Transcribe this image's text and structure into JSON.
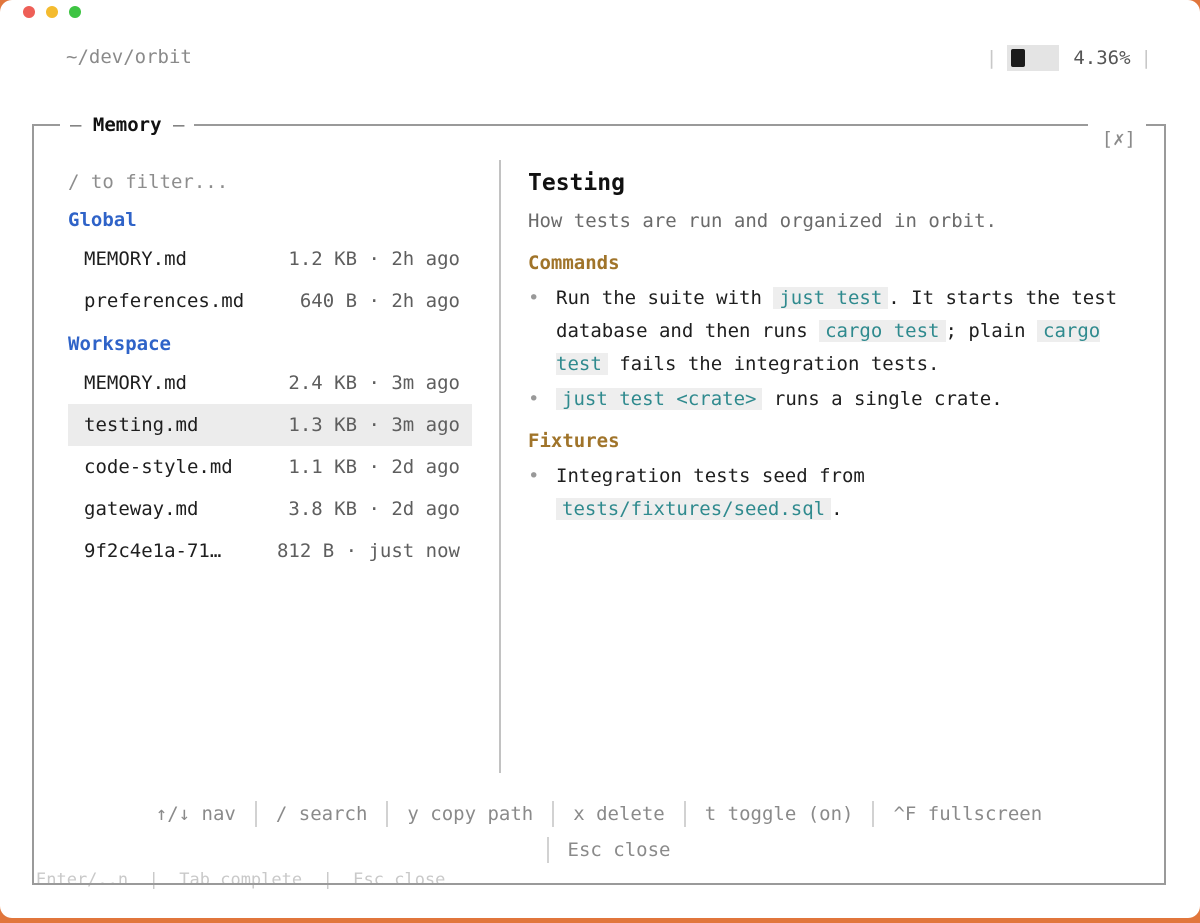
{
  "header": {
    "path": "~/dev/orbit",
    "context_percent": "4.36%"
  },
  "underlay": {
    "text": "Enter/..n  |  Tab complete  |  Esc close"
  },
  "panel": {
    "title": "Memory",
    "title_dash": "—",
    "close_label": "[✗]",
    "filter_placeholder": "/ to filter...",
    "groups": [
      {
        "label": "Global",
        "files": [
          {
            "name": "MEMORY.md",
            "meta": "1.2 KB · 2h ago"
          },
          {
            "name": "preferences.md",
            "meta": "640 B · 2h ago"
          }
        ]
      },
      {
        "label": "Workspace",
        "files": [
          {
            "name": "MEMORY.md",
            "meta": "2.4 KB · 3m ago"
          },
          {
            "name": "testing.md",
            "meta": "1.3 KB · 3m ago"
          },
          {
            "name": "code-style.md",
            "meta": "1.1 KB · 2d ago"
          },
          {
            "name": "gateway.md",
            "meta": "3.8 KB · 2d ago"
          },
          {
            "name": "9f2c4e1a-71…",
            "meta": "812 B · just now"
          }
        ]
      }
    ],
    "doc": {
      "title": "Testing",
      "description": "How tests are run and organized in orbit.",
      "sections": [
        {
          "heading": "Commands",
          "b1": {
            "t1": "Run the suite with ",
            "c1": "just test",
            "t2": ". It starts the test database and then runs ",
            "c2": "cargo test",
            "t3": "; plain ",
            "c3": "cargo test",
            "t4": " fails the integration tests."
          },
          "b2": {
            "c1": "just test <crate>",
            "t1": " runs a single crate."
          }
        },
        {
          "heading": "Fixtures",
          "b1": {
            "t1": "Integration tests seed from ",
            "c1": "tests/fixtures/seed.sql",
            "t2": "."
          }
        }
      ]
    },
    "footer": {
      "hints": [
        "↑/↓ nav",
        "/ search",
        "y copy path",
        "x delete",
        "t toggle (on)",
        "^F fullscreen"
      ],
      "close_hint": "Esc close"
    }
  }
}
